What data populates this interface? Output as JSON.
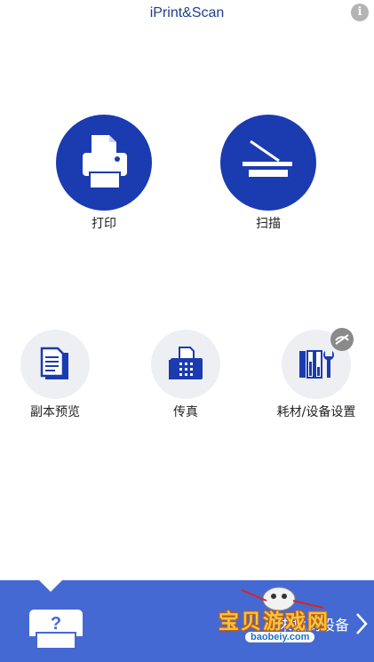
{
  "header": {
    "title": "iPrint&Scan",
    "info_icon": "info-icon",
    "info_label": "i"
  },
  "main_actions": [
    {
      "label": "打印",
      "icon": "printer-icon"
    },
    {
      "label": "扫描",
      "icon": "scanner-icon"
    }
  ],
  "secondary_actions": [
    {
      "label": "副本预览",
      "icon": "copy-preview-icon"
    },
    {
      "label": "传真",
      "icon": "fax-icon"
    },
    {
      "label": "耗材/设备设置",
      "icon": "supplies-tools-icon",
      "badge_icon": "offline-icon"
    }
  ],
  "bottom": {
    "device_icon": "printer-help-icon",
    "device_label": "未找到设备",
    "chevron_icon": "chevron-right-icon"
  },
  "watermark": {
    "text": "宝贝游戏网",
    "url": "baobeiy.com"
  },
  "colors": {
    "brand_blue": "#1b3bb0",
    "bar_blue": "#4569d2",
    "title_blue": "#1f3d8f",
    "small_circle": "#eeeff3"
  }
}
